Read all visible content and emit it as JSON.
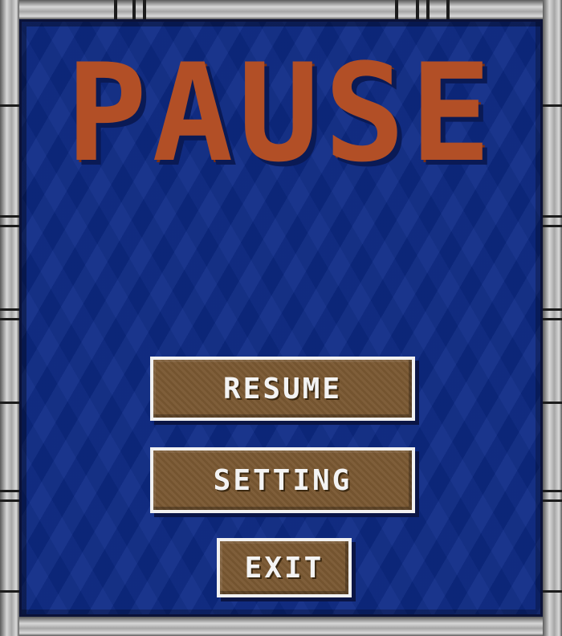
{
  "screen": {
    "title": "PAUSE",
    "colors": {
      "background": "#0d2a86",
      "title": "#b24f26",
      "button_fill": "#7a5832",
      "button_border": "#f1f1f1",
      "frame": "#b5b5b5"
    }
  },
  "menu": {
    "resume_label": "RESUME",
    "setting_label": "SETTING",
    "exit_label": "EXIT"
  }
}
